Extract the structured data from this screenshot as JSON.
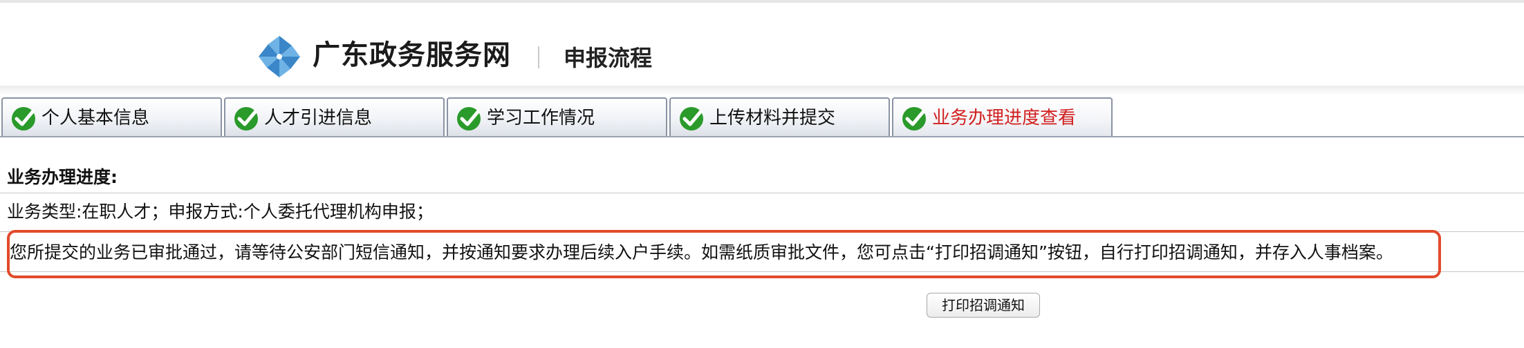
{
  "header": {
    "site_name": "广东政务服务网",
    "page_subtitle": "申报流程",
    "logo_icon": "pinwheel-logo-icon",
    "brand_color": "#3a86c8"
  },
  "tabs": [
    {
      "label": "个人基本信息",
      "status_icon": "check-circle-icon",
      "active": false
    },
    {
      "label": "人才引进信息",
      "status_icon": "check-circle-icon",
      "active": false
    },
    {
      "label": "学习工作情况",
      "status_icon": "check-circle-icon",
      "active": false
    },
    {
      "label": "上传材料并提交",
      "status_icon": "check-circle-icon",
      "active": false
    },
    {
      "label": "业务办理进度查看",
      "status_icon": "check-circle-icon",
      "active": true
    }
  ],
  "colors": {
    "active_tab_text": "#d11f1f",
    "check_green": "#2a9a2a",
    "highlight_border": "#e24a2b"
  },
  "progress": {
    "section_title": "业务办理进度:",
    "business_info": "业务类型:在职人才；申报方式:个人委托代理机构申报；",
    "status_message": "您所提交的业务已审批通过，请等待公安部门短信通知，并按通知要求办理后续入户手续。如需纸质审批文件，您可点击“打印招调通知”按钮，自行打印招调通知，并存入人事档案。"
  },
  "actions": {
    "print_button_label": "打印招调通知"
  }
}
